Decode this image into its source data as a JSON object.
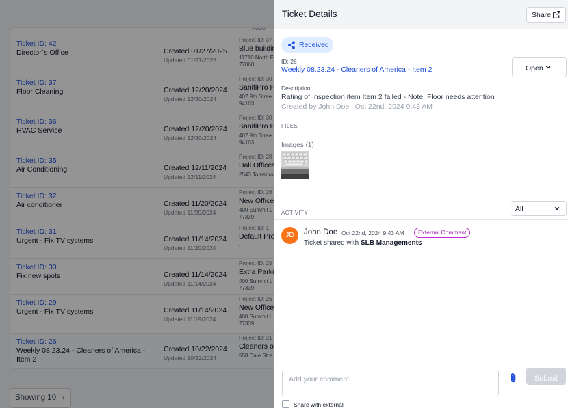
{
  "list": {
    "top_stub": "77060",
    "rows": [
      {
        "id": "Ticket ID: 42",
        "name": "Director`s Office",
        "created": "Created 01/27/2025",
        "updated": "Updated 01/27/2025",
        "project": "Project ID: 37",
        "project_name": "Blue buildin",
        "addr1": "11710 North F",
        "addr2": "77060"
      },
      {
        "id": "Ticket ID: 37",
        "name": "Floor Cleaning",
        "created": "Created 12/20/2024",
        "updated": "Updated 12/20/2024",
        "project": "Project ID: 30",
        "project_name": "SanitiPro Pa",
        "addr1": "407 9th Stree",
        "addr2": "94103"
      },
      {
        "id": "Ticket ID: 36",
        "name": "HVAC Service",
        "created": "Created 12/20/2024",
        "updated": "Updated 12/20/2024",
        "project": "Project ID: 30",
        "project_name": "SanitiPro Pa",
        "addr1": "407 9th Stree",
        "addr2": "94103"
      },
      {
        "id": "Ticket ID: 35",
        "name": "Air Conditioning",
        "created": "Created 12/11/2024",
        "updated": "Updated 12/11/2024",
        "project": "Project ID: 28",
        "project_name": "Hall Offices",
        "addr1": "2543 Tomsbro",
        "addr2": ""
      },
      {
        "id": "Ticket ID: 32",
        "name": "Air conditioner",
        "created": "Created 11/20/2024",
        "updated": "Updated 11/20/2024",
        "project": "Project ID: 26",
        "project_name": "New Offices",
        "addr1": "400 Summit L",
        "addr2": "77339"
      },
      {
        "id": "Ticket ID: 31",
        "name": "Urgent - Fix TV systems",
        "created": "Created 11/14/2024",
        "updated": "Updated 11/20/2024",
        "project": "Project ID: 1",
        "project_name": "Default Proj",
        "addr1": "-",
        "addr2": ""
      },
      {
        "id": "Ticket ID: 30",
        "name": "Fix new spots",
        "created": "Created 11/14/2024",
        "updated": "Updated 11/14/2024",
        "project": "Project ID: 25",
        "project_name": "Extra Parkin",
        "addr1": "400 Summit L",
        "addr2": "77339"
      },
      {
        "id": "Ticket ID: 29",
        "name": "Urgent - Fix TV systems",
        "created": "Created 11/14/2024",
        "updated": "Updated 11/19/2024",
        "project": "Project ID: 26",
        "project_name": "New Offices",
        "addr1": "400 Summit L",
        "addr2": "77339"
      },
      {
        "id": "Ticket ID: 26",
        "name": "Weekly 08.23.24 - Cleaners of America - Item 2",
        "created": "Created 10/22/2024",
        "updated": "Updated 10/22/2024",
        "project": "Project ID: 21",
        "project_name": "Cleaners of",
        "addr1": "558 Dale Stre",
        "addr2": ""
      }
    ],
    "showing": "Showing 10"
  },
  "drawer": {
    "title": "Ticket Details",
    "share_label": "Share",
    "status": "Received",
    "id_label": "ID: 26",
    "ticket_title": "Weekly 08.23.24 - Cleaners of America - Item 2",
    "state": "Open",
    "description_label": "Description:",
    "description": "Rating of Inspection item Item 2 failed - Note: Floor needs attention",
    "created_meta": "Created by John Doe | Oct 22nd, 2024 9:43 AM",
    "files_label": "FILES",
    "images_label": "Images (1)",
    "activity_label": "ACTIVITY",
    "activity_filter": "All",
    "activity": {
      "avatar_initials": "JD",
      "author": "John Doe",
      "time": "Oct 22nd, 2024 9:43 AM",
      "badge": "External Comment",
      "text_prefix": "Ticket shared with ",
      "text_target": "SLB Managements"
    },
    "comment_placeholder": "Add your comment...",
    "submit_label": "Submit",
    "share_external_label": "Share with external"
  },
  "colors": {
    "accent": "#1d4ed8",
    "header_border": "#f59e0b",
    "avatar": "#f97316",
    "external_badge": "#c026d3",
    "status_pill_bg": "#e0ecff"
  }
}
